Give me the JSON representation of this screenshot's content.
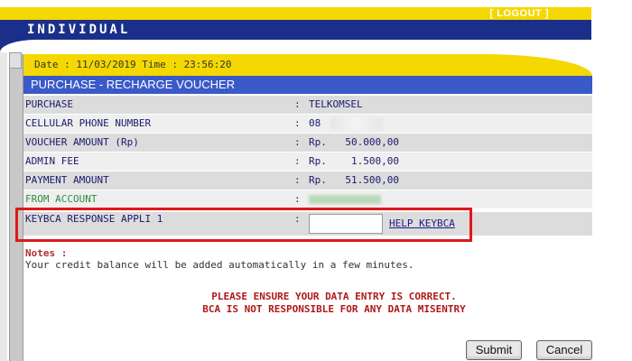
{
  "header": {
    "brand": "INDIVIDUAL",
    "logout_label": "[ LOGOUT ]"
  },
  "date_bar": {
    "text": "Date : 11/03/2019 Time : 23:56:20"
  },
  "page_title": "PURCHASE - RECHARGE VOUCHER",
  "rows": [
    {
      "label": "PURCHASE",
      "sep": ":",
      "value": "TELKOMSEL"
    },
    {
      "label": "CELLULAR PHONE NUMBER",
      "sep": ":",
      "value": "08"
    },
    {
      "label": "VOUCHER AMOUNT (Rp)",
      "sep": ":",
      "currency": "Rp.",
      "amount": "50.000,00"
    },
    {
      "label": "ADMIN FEE",
      "sep": ":",
      "currency": "Rp.",
      "amount": "1.500,00"
    },
    {
      "label": "PAYMENT AMOUNT",
      "sep": ":",
      "currency": "Rp.",
      "amount": "51.500,00"
    },
    {
      "label": "FROM ACCOUNT",
      "sep": ":"
    },
    {
      "label": "KEYBCA RESPONSE APPLI 1",
      "sep": ":"
    }
  ],
  "keybca": {
    "input_value": "",
    "help_label": "HELP KEYBCA"
  },
  "notes": {
    "heading": "Notes :",
    "body": "Your credit balance will be added automatically in a few minutes."
  },
  "warning": {
    "line1": "PLEASE ENSURE YOUR DATA ENTRY IS CORRECT.",
    "line2": "BCA IS NOT RESPONSIBLE FOR ANY DATA MISENTRY"
  },
  "buttons": {
    "submit": "Submit",
    "cancel": "Cancel"
  },
  "colors": {
    "header_yellow": "#f5d800",
    "header_blue": "#1a2f8a",
    "title_blue": "#3a5ac8",
    "highlight_red": "#e01818",
    "warning_red": "#b01818"
  }
}
